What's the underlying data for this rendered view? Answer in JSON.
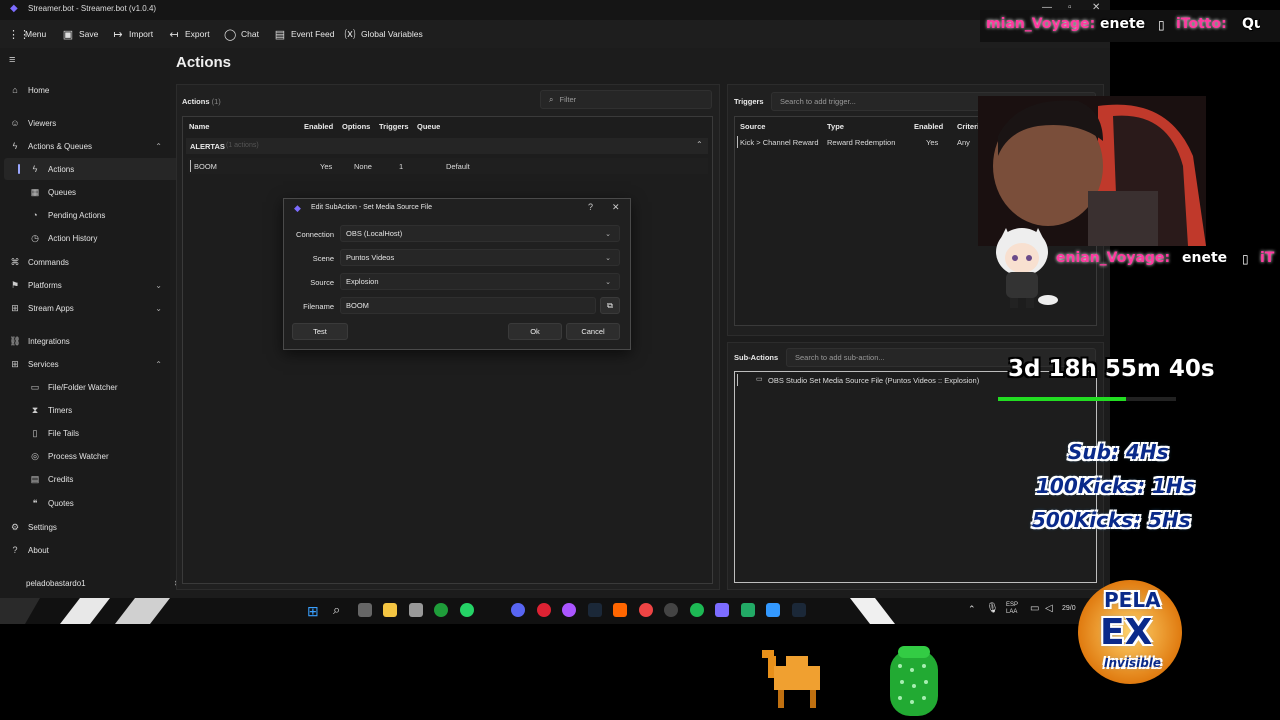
{
  "window": {
    "title": "Streamer.bot - Streamer.bot (v1.0.4)"
  },
  "toolbar": [
    {
      "icon": "grid-menu-icon",
      "label": "Menu"
    },
    {
      "icon": "save-icon",
      "label": "Save"
    },
    {
      "icon": "import-icon",
      "label": "Import"
    },
    {
      "icon": "export-icon",
      "label": "Export"
    },
    {
      "icon": "chat-icon",
      "label": "Chat"
    },
    {
      "icon": "event-feed-icon",
      "label": "Event Feed"
    },
    {
      "icon": "variables-icon",
      "label": "Global Variables"
    }
  ],
  "sidebar": {
    "items": [
      {
        "label": "Home"
      },
      {
        "label": "Viewers"
      },
      {
        "label": "Actions & Queues"
      },
      {
        "label": "Actions"
      },
      {
        "label": "Queues"
      },
      {
        "label": "Pending Actions"
      },
      {
        "label": "Action History"
      },
      {
        "label": "Commands"
      },
      {
        "label": "Platforms"
      },
      {
        "label": "Stream Apps"
      },
      {
        "label": "Integrations"
      },
      {
        "label": "Services"
      },
      {
        "label": "File/Folder Watcher"
      },
      {
        "label": "Timers"
      },
      {
        "label": "File Tails"
      },
      {
        "label": "Process Watcher"
      },
      {
        "label": "Credits"
      },
      {
        "label": "Quotes"
      },
      {
        "label": "Settings"
      },
      {
        "label": "About"
      }
    ],
    "user": "peladobastardo1"
  },
  "main": {
    "title": "Actions",
    "actions_panel": {
      "title": "Actions",
      "count": "(1)",
      "filter_placeholder": "Filter",
      "columns": [
        "Name",
        "Enabled",
        "Options",
        "Triggers",
        "Queue"
      ],
      "group": {
        "name": "ALERTAS",
        "count": "(1 actions)"
      },
      "rows": [
        {
          "name": "BOOM",
          "enabled": "Yes",
          "options": "None",
          "triggers": "1",
          "queue": "Default"
        }
      ]
    },
    "triggers_panel": {
      "title": "Triggers",
      "search_placeholder": "Search to add trigger...",
      "columns": [
        "Source",
        "Type",
        "Enabled",
        "Criteria"
      ],
      "rows": [
        {
          "source": "Kick > Channel Reward",
          "type": "Reward Redemption",
          "enabled": "Yes",
          "criteria": "Any"
        }
      ]
    },
    "subactions_panel": {
      "title": "Sub-Actions",
      "search_placeholder": "Search to add sub-action...",
      "items": [
        "OBS Studio Set Media Source File (Puntos Videos :: Explosion)"
      ]
    }
  },
  "dialog": {
    "title": "Edit SubAction - Set Media Source File",
    "help": "?",
    "close": "✕",
    "fields": {
      "connection": {
        "label": "Connection",
        "value": "OBS (LocalHost)"
      },
      "scene": {
        "label": "Scene",
        "value": "Puntos Videos"
      },
      "source": {
        "label": "Source",
        "value": "Explosion"
      },
      "filename": {
        "label": "Filename",
        "value": "BOOM"
      }
    },
    "test_label": "Test",
    "ok_label": "Ok",
    "cancel_label": "Cancel"
  },
  "overlay": {
    "chat_top": [
      {
        "user": "mian_Voyage:",
        "msg": "enete"
      },
      {
        "user": "iTotto:",
        "msg": "Que f"
      }
    ],
    "chat_mid": [
      {
        "user": "enian_Voyage:",
        "msg": "enete"
      },
      {
        "user": "iT",
        "msg": ""
      }
    ],
    "timer": "3d 18h 55m 40s",
    "timer_progress": 0.72,
    "goals": [
      "Sub: 4Hs",
      "100Kicks: 1Hs",
      "500Kicks: 5Hs"
    ],
    "badge": {
      "line1": "PELA",
      "line2": "EX",
      "line3": "Invisible"
    }
  },
  "taskbar": {
    "lang": "ESP\nLAA",
    "time": "29/0"
  },
  "colors": {
    "accent": "#9aa7ff",
    "app_bg": "#1c1c1c",
    "panel_bg": "#202020",
    "progress": "#22dd22",
    "chat_user": "#ff3aa0"
  }
}
